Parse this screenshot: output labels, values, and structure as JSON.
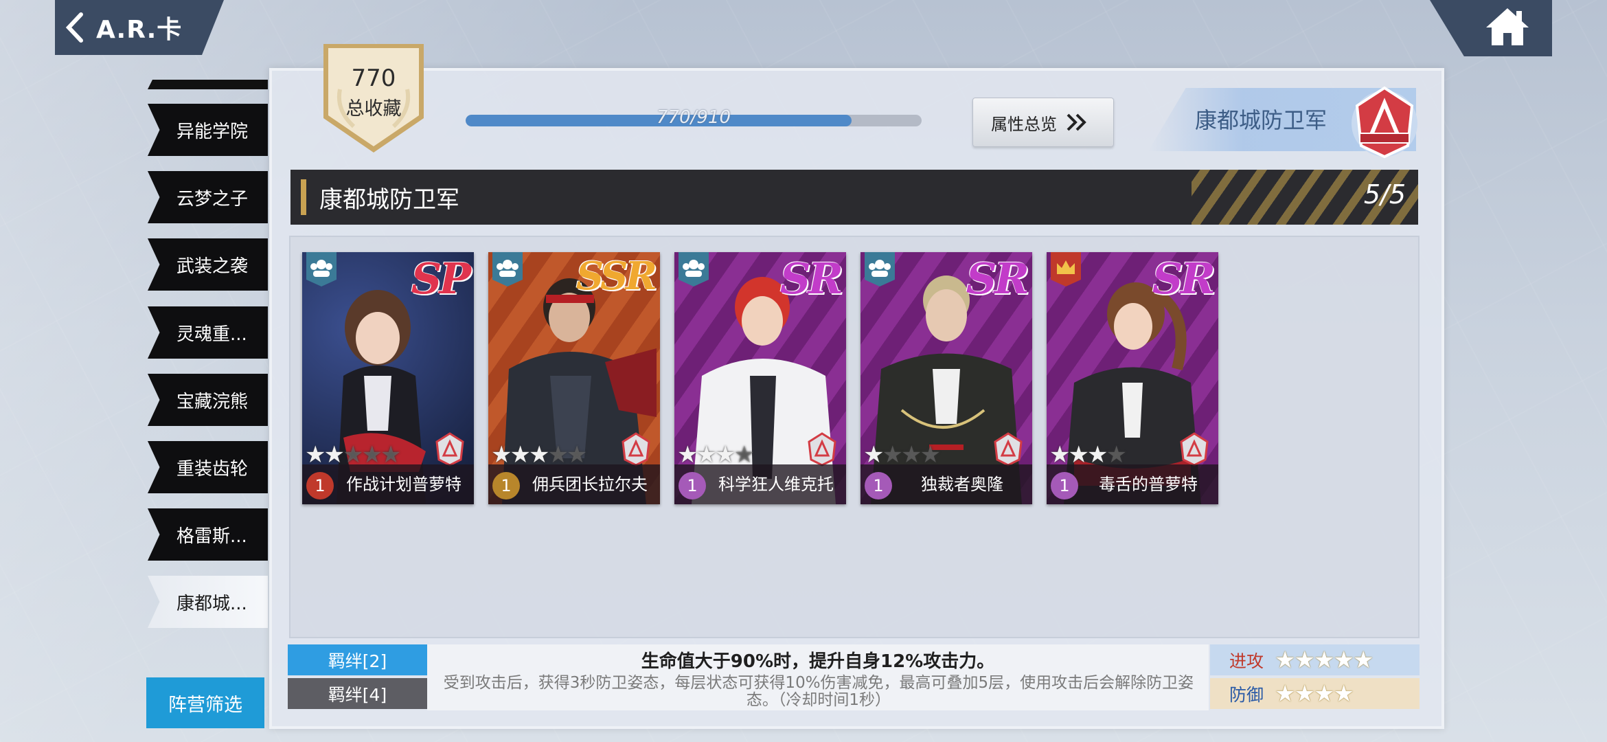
{
  "header": {
    "back_title": "A.R.卡"
  },
  "sidebar": {
    "items": [
      {
        "label": "异能学院",
        "active": false
      },
      {
        "label": "云梦之子",
        "active": false
      },
      {
        "label": "武装之袭",
        "active": false
      },
      {
        "label": "灵魂重...",
        "active": false
      },
      {
        "label": "宝藏浣熊",
        "active": false
      },
      {
        "label": "重装齿轮",
        "active": false
      },
      {
        "label": "格雷斯...",
        "active": false
      },
      {
        "label": "康都城...",
        "active": true
      }
    ],
    "filter_label": "阵营筛选"
  },
  "collection": {
    "total": "770",
    "label": "总收藏",
    "progress_text": "770/910",
    "progress_value": 770,
    "progress_max": 910
  },
  "attr_button": {
    "label": "属性总览"
  },
  "faction": {
    "name": "康都城防卫军"
  },
  "set": {
    "title": "康都城防卫军",
    "count": "5/5"
  },
  "cards": [
    {
      "name": "作战计划普萝特",
      "rarity": "SP",
      "level": "1",
      "stars": 2,
      "max_stars": 5,
      "role": "team-icon",
      "level_color": "#c0392b",
      "bg": "#1b2240"
    },
    {
      "name": "佣兵团长拉尔夫",
      "rarity": "SSR",
      "level": "1",
      "stars": 3,
      "max_stars": 5,
      "role": "team-icon",
      "level_color": "#b8862b",
      "bg": "#b4552b"
    },
    {
      "name": "科学狂人维克托",
      "rarity": "SR",
      "level": "1",
      "stars": 3,
      "max_stars": 4,
      "role": "team-icon",
      "level_color": "#a55ab8",
      "bg": "#7b2b83"
    },
    {
      "name": "独裁者奥隆",
      "rarity": "SR",
      "level": "1",
      "stars": 1,
      "max_stars": 4,
      "role": "team-icon",
      "level_color": "#a55ab8",
      "bg": "#7b2b83"
    },
    {
      "name": "毒舌的普萝特",
      "rarity": "SR",
      "level": "1",
      "stars": 3,
      "max_stars": 4,
      "role": "crown-icon",
      "level_color": "#a55ab8",
      "bg": "#7b2b83"
    }
  ],
  "bonds": [
    {
      "label": "羁绊[2]",
      "text": "生命值大于90%时，提升自身12%攻击力。"
    },
    {
      "label": "羁绊[4]",
      "text": "受到攻击后，获得3秒防卫姿态，每层状态可获得10%伤害减免，最高可叠加5层，使用攻击后会解除防卫姿态。（冷却时间1秒）"
    }
  ],
  "stats": {
    "attack_label": "进攻",
    "attack_stars": 5,
    "defense_label": "防御",
    "defense_stars": 4
  }
}
